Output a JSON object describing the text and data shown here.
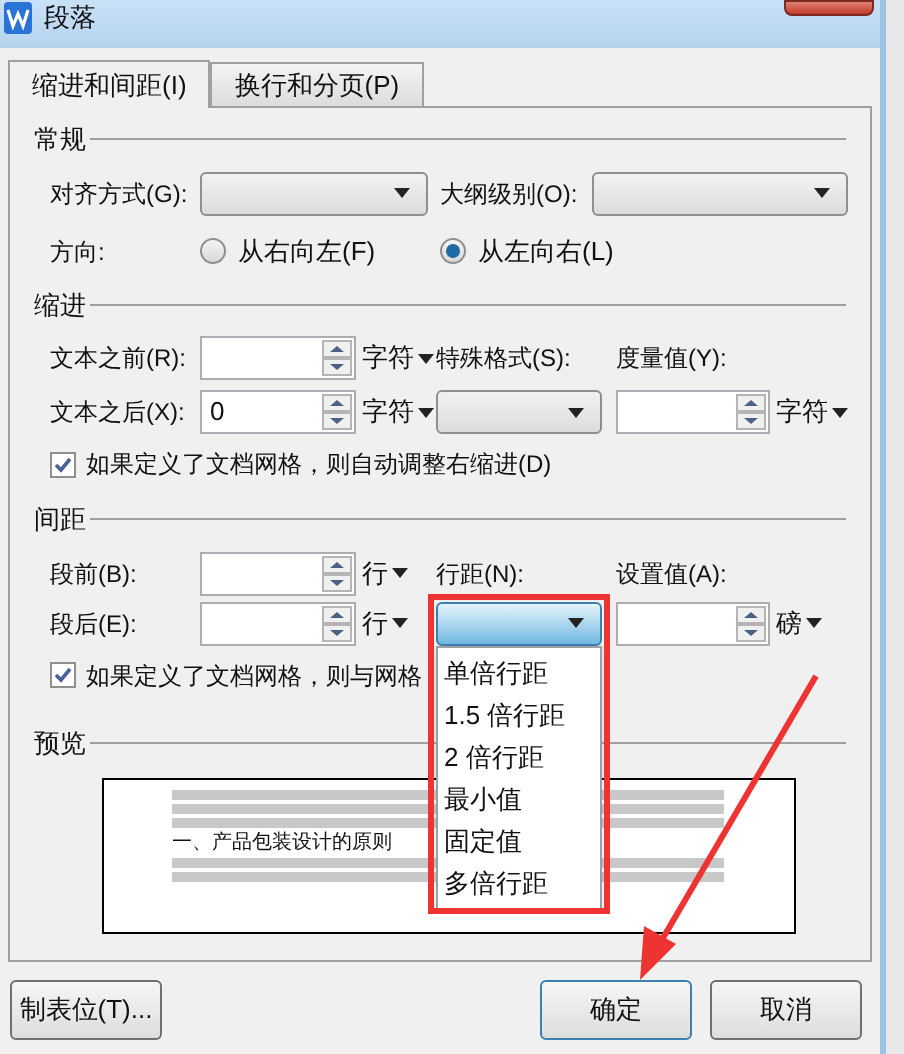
{
  "window": {
    "title": "段落"
  },
  "tabs": [
    {
      "label": "缩进和间距(I)",
      "selected": true
    },
    {
      "label": "换行和分页(P)",
      "selected": false
    }
  ],
  "general": {
    "heading": "常规",
    "alignment": {
      "label": "对齐方式(G):"
    },
    "outline": {
      "label": "大纲级别(O):"
    },
    "direction": {
      "label": "方向:",
      "options": [
        {
          "label": "从右向左(F)",
          "selected": false
        },
        {
          "label": "从左向右(L)",
          "selected": true
        }
      ]
    }
  },
  "indent": {
    "heading": "缩进",
    "before": {
      "label": "文本之前(R):",
      "unit": "字符"
    },
    "after": {
      "label": "文本之后(X):",
      "value": "0",
      "unit": "字符"
    },
    "special": {
      "label": "特殊格式(S):"
    },
    "measure": {
      "label": "度量值(Y):",
      "unit": "字符"
    },
    "grid_option": {
      "label": "如果定义了文档网格，则自动调整右缩进(D)",
      "checked": true
    }
  },
  "spacing": {
    "heading": "间距",
    "before": {
      "label": "段前(B):",
      "unit": "行"
    },
    "after": {
      "label": "段后(E):",
      "unit": "行"
    },
    "line_spacing": {
      "label": "行距(N):",
      "expanded": true,
      "options": [
        {
          "label": "单倍行距"
        },
        {
          "label": "1.5 倍行距"
        },
        {
          "label": "2 倍行距"
        },
        {
          "label": "最小值"
        },
        {
          "label": "固定值"
        },
        {
          "label": "多倍行距"
        }
      ]
    },
    "set_value": {
      "label": "设置值(A):",
      "unit": "磅"
    },
    "grid_option": {
      "label": "如果定义了文档网格，则与网格",
      "checked": true
    }
  },
  "preview": {
    "heading": "预览",
    "heading_line": "一、产品包装设计的原则"
  },
  "buttons": [
    {
      "label": "制表位(T)...",
      "kind": "secondary"
    },
    {
      "label": "确定",
      "kind": "default"
    },
    {
      "label": "取消",
      "kind": "secondary"
    }
  ]
}
